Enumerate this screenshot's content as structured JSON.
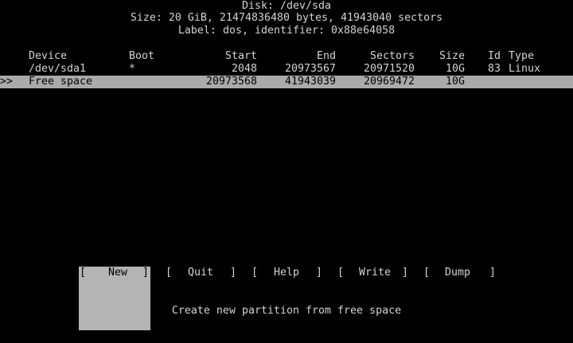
{
  "disk": {
    "title": "Disk: /dev/sda",
    "size_line": "Size: 20 GiB, 21474836480 bytes, 41943040 sectors",
    "label_line": "Label: dos, identifier: 0x88e64058"
  },
  "table": {
    "headers": {
      "device": "Device",
      "boot": "Boot",
      "start": "Start",
      "end": "End",
      "sectors": "Sectors",
      "size": "Size",
      "id": "Id",
      "type": "Type"
    },
    "rows": [
      {
        "marker": "",
        "device": "/dev/sda1",
        "boot": "*",
        "start": "2048",
        "end": "20973567",
        "sectors": "20971520",
        "size": "10G",
        "id": "83",
        "type": "Linux"
      },
      {
        "marker": ">>",
        "device": "Free space",
        "boot": "",
        "start": "20973568",
        "end": "41943039",
        "sectors": "20969472",
        "size": "10G",
        "id": "",
        "type": ""
      }
    ]
  },
  "menu": {
    "open_bracket": "[",
    "close_bracket": "]",
    "items": [
      {
        "label": "New"
      },
      {
        "label": "Quit"
      },
      {
        "label": "Help"
      },
      {
        "label": "Write"
      },
      {
        "label": "Dump"
      }
    ]
  },
  "status": {
    "hint": "Create new partition from free space"
  },
  "colors": {
    "background": "#000000",
    "foreground": "#d3d3d3",
    "selection_bg": "#aaaaaa",
    "active_button_bg": "#b4b4b4"
  }
}
